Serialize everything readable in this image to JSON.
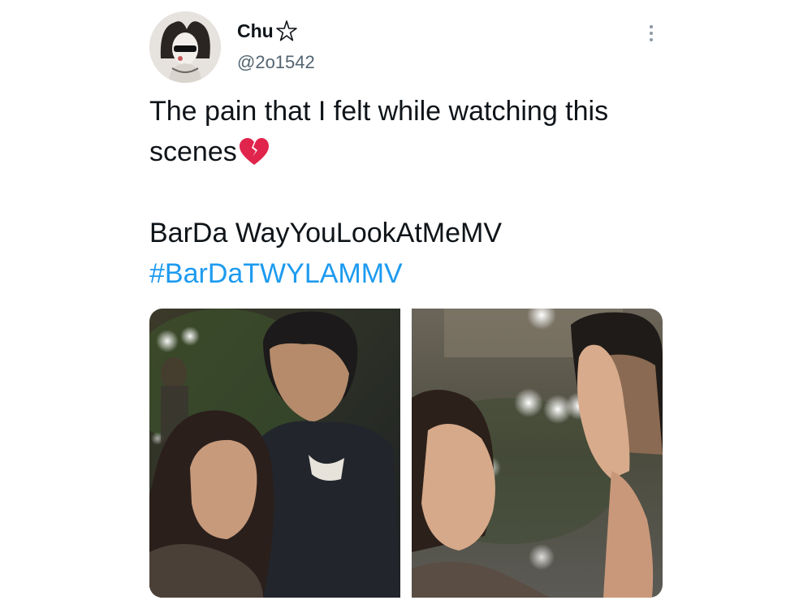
{
  "user": {
    "display_name": "Chu",
    "name_icon": "star-icon",
    "handle": "@2o1542"
  },
  "menu": {
    "icon": "more-vertical-icon"
  },
  "tweet": {
    "line1": "The pain that I felt while watching this scenes",
    "emoji": "broken-heart-icon",
    "line2": "BarDa WayYouLookAtMeMV",
    "hashtag": "#BarDaTWYLAMMV"
  },
  "media": {
    "count": 2,
    "items": [
      {
        "name": "photo-left-couple-embrace"
      },
      {
        "name": "photo-right-woman-looking-up"
      }
    ]
  },
  "colors": {
    "text": "#0f1419",
    "secondary": "#536471",
    "link": "#1d9bf0",
    "heart": "#e0244c"
  }
}
